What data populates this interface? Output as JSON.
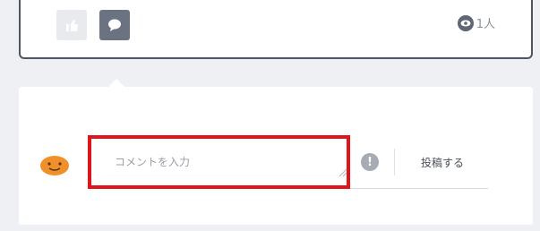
{
  "post": {
    "like_icon": "thumbs-up-icon",
    "comment_icon": "speech-bubble-icon",
    "viewer_icon": "eye-icon",
    "viewer_count": "1人"
  },
  "comment": {
    "avatar_icon": "orange-smiley-avatar",
    "input_placeholder": "コメントを入力",
    "input_value": "",
    "info_icon_glyph": "!",
    "submit_label": "投稿する",
    "highlight_color": "#e0151c"
  }
}
